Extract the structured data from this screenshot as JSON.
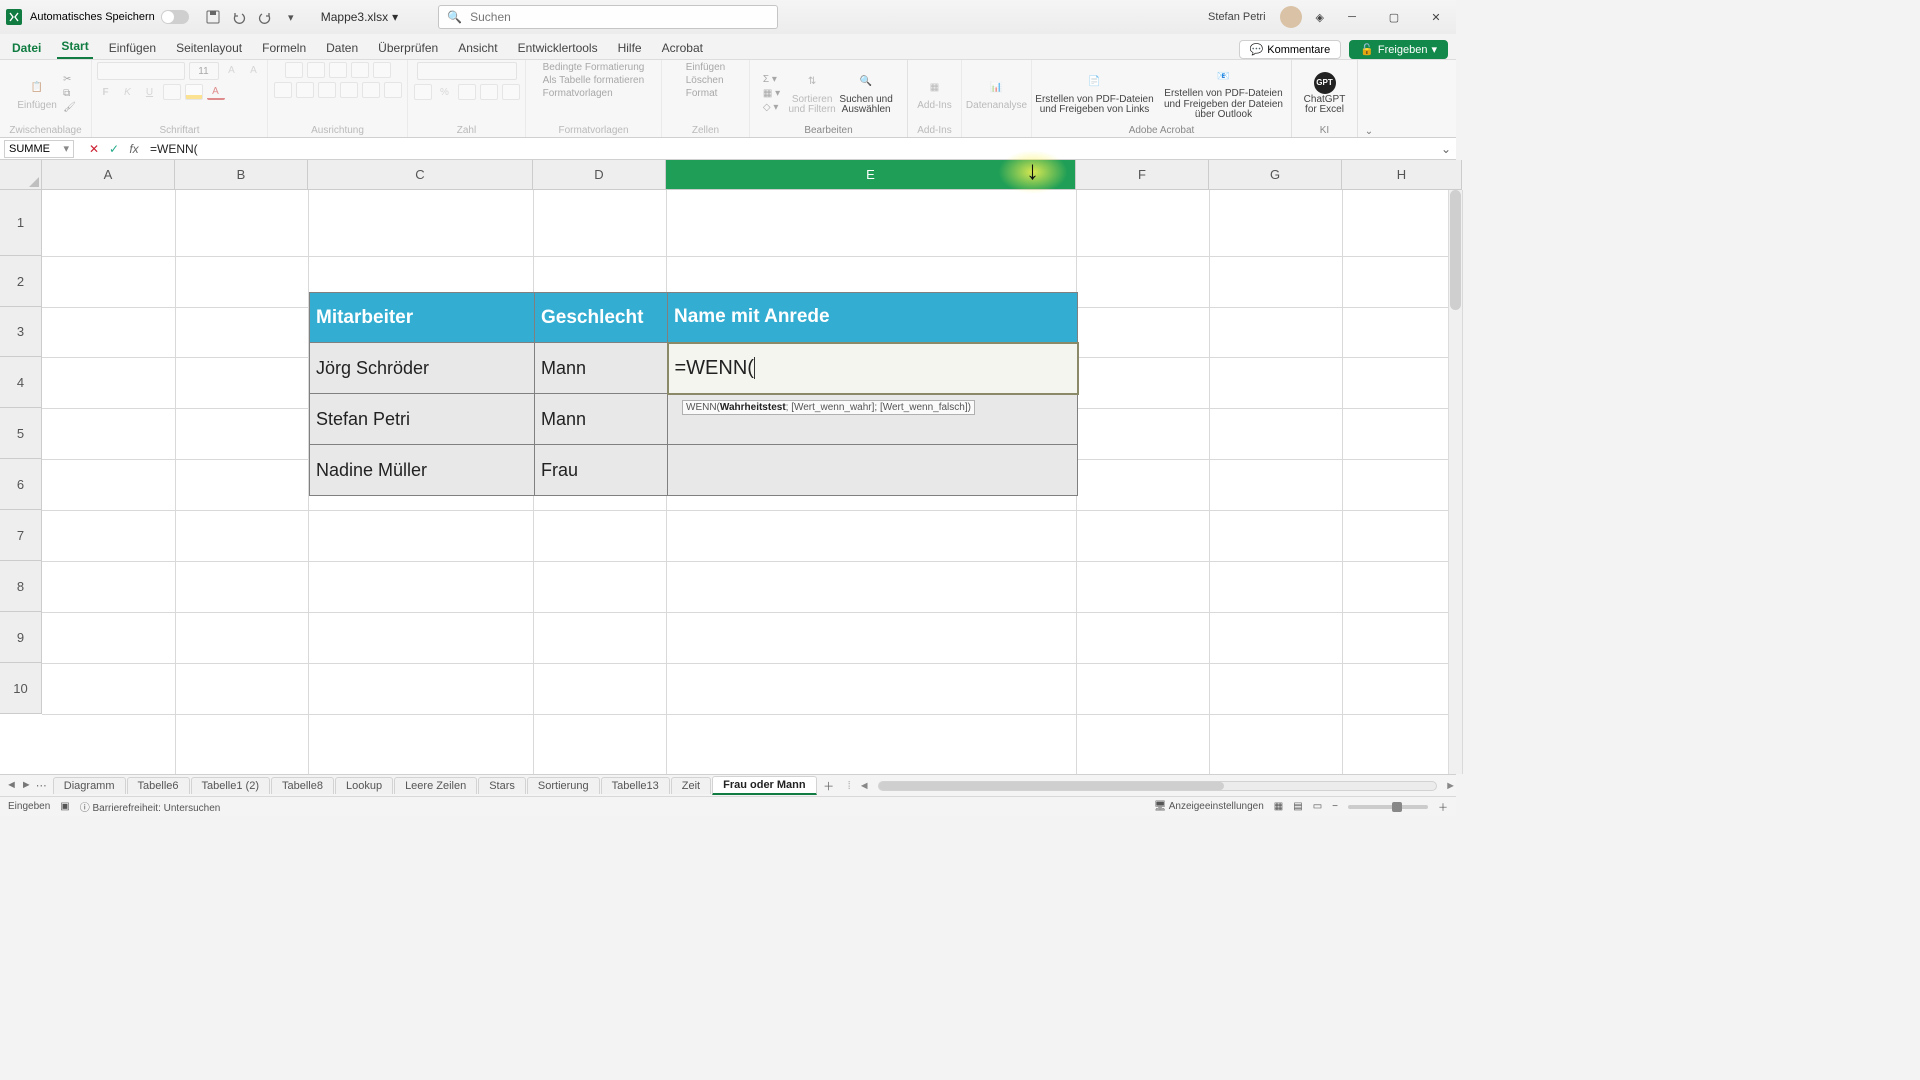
{
  "title_bar": {
    "autosave_label": "Automatisches Speichern",
    "doc_name": "Mappe3.xlsx",
    "search_placeholder": "Suchen",
    "user_name": "Stefan Petri"
  },
  "ribbon_tabs": {
    "file": "Datei",
    "start": "Start",
    "einfuegen": "Einfügen",
    "seitenlayout": "Seitenlayout",
    "formeln": "Formeln",
    "daten": "Daten",
    "ueberpruefen": "Überprüfen",
    "ansicht": "Ansicht",
    "entwicklertools": "Entwicklertools",
    "hilfe": "Hilfe",
    "acrobat": "Acrobat",
    "kommentare": "Kommentare",
    "freigeben": "Freigeben"
  },
  "ribbon_groups": {
    "einfuegen_btn": "Einfügen",
    "zwischenablage": "Zwischenablage",
    "schriftart": "Schriftart",
    "font_size": "11",
    "ausrichtung": "Ausrichtung",
    "zahl": "Zahl",
    "bedingte": "Bedingte Formatierung",
    "alstabelle": "Als Tabelle formatieren",
    "formatvorlagen_btn": "Formatvorlagen",
    "formatvorlagen": "Formatvorlagen",
    "zellen_einf": "Einfügen",
    "zellen_loesch": "Löschen",
    "zellen_format": "Format",
    "zellen": "Zellen",
    "sortieren": "Sortieren und Filtern",
    "suchen": "Suchen und Auswählen",
    "bearbeiten": "Bearbeiten",
    "addins_btn": "Add-Ins",
    "addins": "Add-Ins",
    "datenanalyse": "Datenanalyse",
    "pdf_links": "Erstellen von PDF-Dateien und Freigeben von Links",
    "pdf_outlook": "Erstellen von PDF-Dateien und Freigeben der Dateien über Outlook",
    "adobe": "Adobe Acrobat",
    "chatgpt": "ChatGPT for Excel",
    "ki": "KI"
  },
  "formula_bar": {
    "name_box": "SUMME",
    "formula": "=WENN("
  },
  "columns": [
    "A",
    "B",
    "C",
    "D",
    "E",
    "F",
    "G",
    "H"
  ],
  "rows": [
    "1",
    "2",
    "3",
    "4",
    "5",
    "6",
    "7",
    "8",
    "9",
    "10"
  ],
  "table": {
    "h1": "Mitarbeiter",
    "h2": "Geschlecht",
    "h3": "Name mit Anrede",
    "r1c1": "Jörg Schröder",
    "r1c2": "Mann",
    "r1c3": "=WENN(",
    "r2c1": "Stefan Petri",
    "r2c2": "Mann",
    "r3c1": "Nadine Müller",
    "r3c2": "Frau"
  },
  "tooltip": {
    "fn": "WENN(",
    "arg1": "Wahrheitstest",
    "rest": "; [Wert_wenn_wahr]; [Wert_wenn_falsch])"
  },
  "sheet_tabs": {
    "s1": "Diagramm",
    "s2": "Tabelle6",
    "s3": "Tabelle1 (2)",
    "s4": "Tabelle8",
    "s5": "Lookup",
    "s6": "Leere Zeilen",
    "s7": "Stars",
    "s8": "Sortierung",
    "s9": "Tabelle13",
    "s10": "Zeit",
    "active": "Frau oder Mann"
  },
  "status": {
    "mode": "Eingeben",
    "access": "Barrierefreiheit: Untersuchen",
    "display": "Anzeigeeinstellungen"
  }
}
